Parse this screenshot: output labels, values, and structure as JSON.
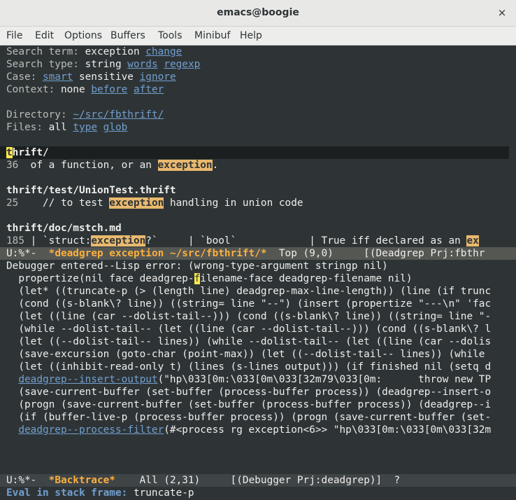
{
  "window": {
    "title": "emacs@boogie",
    "close_glyph": "×"
  },
  "menu": [
    "File",
    "Edit",
    "Options",
    "Buffers",
    "Tools",
    "Minibuf",
    "Help"
  ],
  "deadgrep": {
    "search_term_label": "Search term: ",
    "search_term_value": "exception",
    "search_term_change": "change",
    "search_type_label": "Search type: ",
    "search_type_value": "string",
    "search_type_words": "words",
    "search_type_regexp": "regexp",
    "case_label": "Case: ",
    "case_smart": "smart",
    "case_value": "sensitive",
    "case_ignore": "ignore",
    "context_label": "Context: ",
    "context_value": "none",
    "context_before": "before",
    "context_after": "after",
    "directory_label": "Directory: ",
    "directory_value": "~/src/fbthrift/",
    "files_label": "Files: ",
    "files_value": "all",
    "files_type": "type",
    "files_glob": "glob",
    "results": [
      {
        "file": "thrift/",
        "lineno": "36",
        "before": "  of a function, or an ",
        "match": "exception",
        "after": "."
      },
      {
        "file": "thrift/test/UnionTest.thrift",
        "lineno": "25",
        "before": "    // to test ",
        "match": "exception",
        "after": " handling in union code"
      },
      {
        "file": "thrift/doc/mstch.md",
        "lineno": "185",
        "before": " | `struct:",
        "match": "exception",
        "after": "?`     | `bool`            | True iff declared as an ",
        "match2": "ex"
      }
    ]
  },
  "modeline_top": {
    "flags": "U:%*-  ",
    "buffer": "*deadgrep exception ~/src/fbthrift/*",
    "position": "  Top (9,0)     [(Deadgrep Prj:fbthr"
  },
  "backtrace": {
    "lines": [
      "Debugger entered--Lisp error: (wrong-type-argument stringp nil)",
      "  propertize(nil face deadgrep-filename-face deadgrep-filename nil)",
      "  (let* ((truncate-p (> (length line) deadgrep-max-line-length)) (line (if trunc",
      "  (cond ((s-blank\\? line)) ((string= line \"--\") (insert (propertize \"---\\n\" 'fac",
      "  (let ((line (car --dolist-tail--))) (cond ((s-blank\\? line)) ((string= line \"-",
      "  (while --dolist-tail-- (let ((line (car --dolist-tail--))) (cond ((s-blank\\? l",
      "  (let ((--dolist-tail-- lines)) (while --dolist-tail-- (let ((line (car --dolis",
      "  (save-excursion (goto-char (point-max)) (let ((--dolist-tail-- lines)) (while",
      "  (let ((inhibit-read-only t) (lines (s-lines output))) (if finished nil (setq d"
    ],
    "insert_fn": "deadgrep--insert-output",
    "insert_args": "(\"hp\\033[0m:\\033[0m\\033[32m79\\033[0m:      throw new TP",
    "lines2": [
      "  (save-current-buffer (set-buffer (process-buffer process)) (deadgrep--insert-o",
      "  (progn (save-current-buffer (set-buffer (process-buffer process)) (deadgrep--i",
      "  (if (buffer-live-p (process-buffer process)) (progn (save-current-buffer (set-"
    ],
    "filter_fn": "deadgrep--process-filter",
    "filter_args": "(#<process rg exception<6>> \"hp\\033[0m:\\033[0m\\033[32m"
  },
  "modeline_bottom": {
    "flags": "U:%*-  ",
    "buffer": "*Backtrace*",
    "position": "    All (2,31)     [(Debugger Prj:deadgrep)]  ?"
  },
  "minibuffer": {
    "prompt": "Eval in stack frame:",
    "value": " truncate-p"
  },
  "colors": {
    "background": "#2e3436",
    "link": "#729fcf",
    "match_highlight": "#e9b96e",
    "buffer_name": "#fcaf3e"
  }
}
